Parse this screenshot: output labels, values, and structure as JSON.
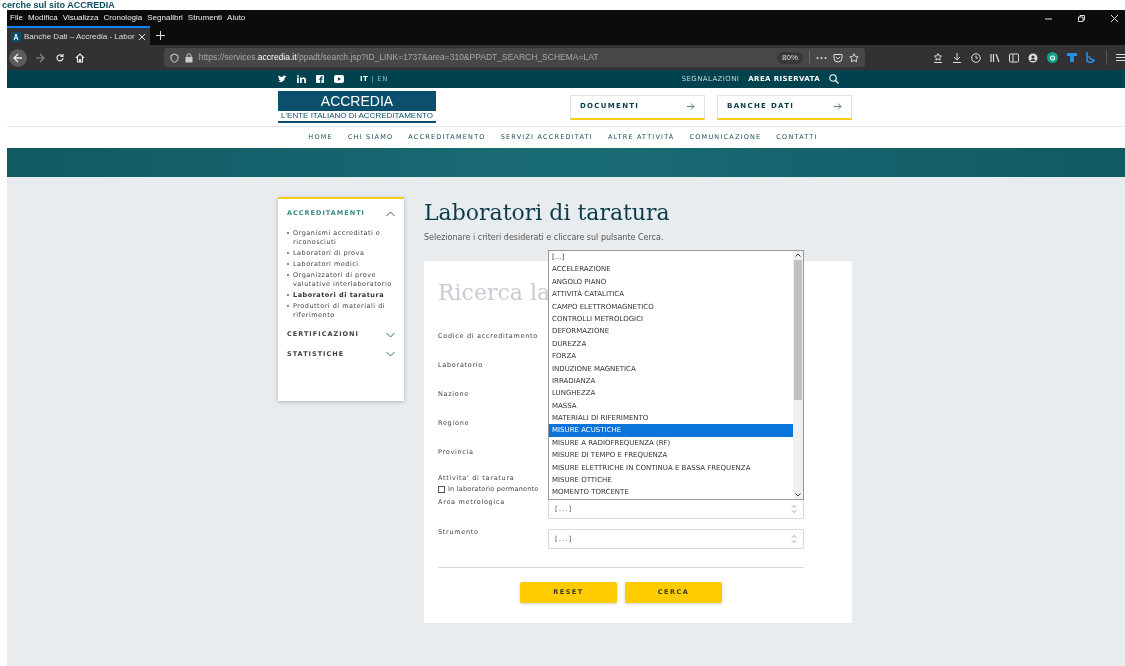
{
  "slide_title": "cerche sul sito ACCREDIA",
  "browser": {
    "menu": [
      "File",
      "Modifica",
      "Visualizza",
      "Cronologia",
      "Segnalibri",
      "Strumenti",
      "Aiuto"
    ],
    "tab": {
      "title": "Banche Dati – Accredia - Labor",
      "selected": true
    },
    "url": "https://services.**accredia.it**/ppadt/search.jsp?ID_LINK=1737&area=310&PPADT_SEARCH_SCHEMA=LAT",
    "zoom": "80%"
  },
  "site": {
    "languages": [
      {
        "label": "IT",
        "selected": true
      },
      {
        "label": "EN",
        "selected": false
      }
    ],
    "language_separator": "|",
    "top_links": [
      "SEGNALAZIONI",
      "AREA RISERVATA"
    ],
    "logo": {
      "name": "ACCREDIA",
      "tagline": "L'ENTE ITALIANO DI ACCREDITAMENTO"
    },
    "header_buttons": [
      "DOCUMENTI",
      "BANCHE DATI"
    ],
    "nav": [
      "HOME",
      "CHI SIAMO",
      "ACCREDITAMENTO",
      "SERVIZI ACCREDITATI",
      "ALTRE ATTIVITÀ",
      "COMUNICAZIONE",
      "CONTATTI"
    ]
  },
  "sidebar": [
    {
      "title": "ACCREDITAMENTI",
      "expanded": true,
      "items": [
        {
          "label": "Organismi accreditati e riconosciuti",
          "selected": false
        },
        {
          "label": "Laboratori di prova",
          "selected": false
        },
        {
          "label": "Laboratori medici",
          "selected": false
        },
        {
          "label": "Organizzatori di prove valutative interlaboratorio",
          "selected": false
        },
        {
          "label": "Laboratori di taratura",
          "selected": true
        },
        {
          "label": "Produttori di materiali di riferimento",
          "selected": false
        }
      ]
    },
    {
      "title": "CERTIFICAZIONI",
      "expanded": false
    },
    {
      "title": "STATISTICHE",
      "expanded": false
    }
  ],
  "page_title": "Laboratori di taratura",
  "instructions": "Selezionare i criteri desiderati e cliccare sul pulsante Cerca.",
  "form": {
    "heading": "Ricerca la",
    "fields": [
      {
        "label": "Codice di accreditamento",
        "kind": "hidden"
      },
      {
        "label": "Laboratorio",
        "kind": "hidden"
      },
      {
        "label": "Nazione",
        "kind": "hidden"
      },
      {
        "label": "Regione",
        "kind": "hidden"
      },
      {
        "label": "Provincia",
        "kind": "hidden"
      },
      {
        "label": "Attivita' di taratura",
        "kind": "hidden"
      },
      {
        "label": "In laboratorio permanente",
        "kind": "checkbox",
        "checked": false
      },
      {
        "label": "Area metrologica",
        "kind": "select",
        "value": "[...]"
      },
      {
        "label": "Strumento",
        "kind": "select",
        "value": "[...]"
      }
    ],
    "buttons": [
      "RESET",
      "CERCA"
    ]
  },
  "dropdown": {
    "options": [
      {
        "label": "[...]",
        "selected": false
      },
      {
        "label": "ACCELERAZIONE",
        "selected": false
      },
      {
        "label": "ANGOLO PIANO",
        "selected": false
      },
      {
        "label": "ATTIVITÀ CATALITICA",
        "selected": false
      },
      {
        "label": "CAMPO ELETTROMAGNETICO",
        "selected": false
      },
      {
        "label": "CONTROLLI METROLOGICI",
        "selected": false
      },
      {
        "label": "DEFORMAZIONE",
        "selected": false
      },
      {
        "label": "DUREZZA",
        "selected": false
      },
      {
        "label": "FORZA",
        "selected": false
      },
      {
        "label": "INDUZIONE MAGNETICA",
        "selected": false
      },
      {
        "label": "IRRADIANZA",
        "selected": false
      },
      {
        "label": "LUNGHEZZA",
        "selected": false
      },
      {
        "label": "MASSA",
        "selected": false
      },
      {
        "label": "MATERIALI DI RIFERIMENTO",
        "selected": false
      },
      {
        "label": "MISURE ACUSTICHE",
        "selected": true
      },
      {
        "label": "MISURE A RADIOFREQUENZA (RF)",
        "selected": false
      },
      {
        "label": "MISURE DI TEMPO E FREQUENZA",
        "selected": false
      },
      {
        "label": "MISURE ELETTRICHE IN CONTINUA E BASSA FREQUENZA",
        "selected": false
      },
      {
        "label": "MISURE OTTICHE",
        "selected": false
      },
      {
        "label": "MOMENTO TORCENTE",
        "selected": false
      }
    ]
  }
}
